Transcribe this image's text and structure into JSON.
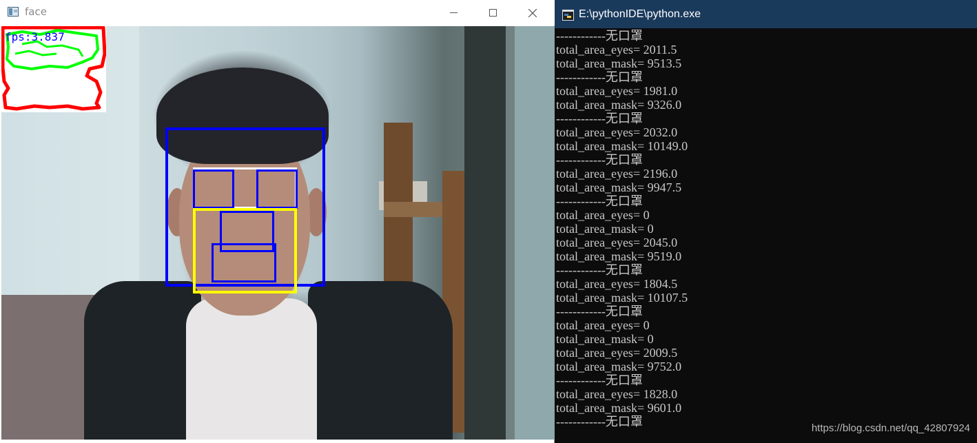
{
  "face_window": {
    "title": "face",
    "fps_text": "fps:3.837"
  },
  "console_window": {
    "title": "E:\\pythonIDE\\python.exe",
    "lines": [
      "------------无口罩",
      "total_area_eyes= 2011.5",
      "total_area_mask= 9513.5",
      "------------无口罩",
      "total_area_eyes= 1981.0",
      "total_area_mask= 9326.0",
      "------------无口罩",
      "total_area_eyes= 2032.0",
      "total_area_mask= 10149.0",
      "------------无口罩",
      "total_area_eyes= 2196.0",
      "total_area_mask= 9947.5",
      "------------无口罩",
      "total_area_eyes= 0",
      "total_area_mask= 0",
      "total_area_eyes= 2045.0",
      "total_area_mask= 9519.0",
      "------------无口罩",
      "total_area_eyes= 1804.5",
      "total_area_mask= 10107.5",
      "------------无口罩",
      "total_area_eyes= 0",
      "total_area_mask= 0",
      "total_area_eyes= 2009.5",
      "total_area_mask= 9752.0",
      "------------无口罩",
      "total_area_eyes= 1828.0",
      "total_area_mask= 9601.0",
      "------------无口罩"
    ]
  },
  "watermark": "https://blog.csdn.net/qq_42807924",
  "colors": {
    "face_box": "#0000ff",
    "eyes_region": "#ffffff",
    "mask_region": "#ffff00",
    "contour_outer": "#ff0000",
    "contour_inner": "#00ff00",
    "console_bg": "#0c0c0c",
    "console_titlebar": "#1a3a5c"
  },
  "icons": {
    "face_app": "opencv-window-icon",
    "console_app": "python-console-icon"
  }
}
